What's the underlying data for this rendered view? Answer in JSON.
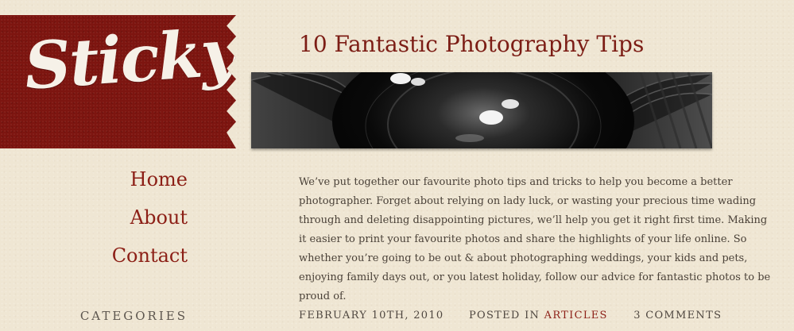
{
  "logo": {
    "text": "Sticky"
  },
  "nav": {
    "items": [
      {
        "label": "Home"
      },
      {
        "label": "About"
      },
      {
        "label": "Contact"
      }
    ]
  },
  "sidebar": {
    "categories_heading": "CATEGORIES"
  },
  "post": {
    "title": "10 Fantastic Photography Tips",
    "body": "We’ve put together our favourite photo tips and tricks to help you become a better photographer. Forget about relying on lady luck, or wasting your precious time wading through and deleting disappointing pictures, we’ll help you get it right first time. Making it easier to print your favourite photos and share the highlights of your life online. So whether you’re going to be out & about photographing weddings, your kids and pets, enjoying family days out, or you latest holiday, follow our advice for fantastic photos to be proud of.",
    "meta": {
      "date": "FEBRUARY 10TH, 2010",
      "posted_in_label": "POSTED IN",
      "category": "ARTICLES",
      "comments": "3 COMMENTS"
    }
  },
  "colors": {
    "brand_red": "#7d1510",
    "link_red": "#8c1f16",
    "background": "#efe6d3"
  }
}
